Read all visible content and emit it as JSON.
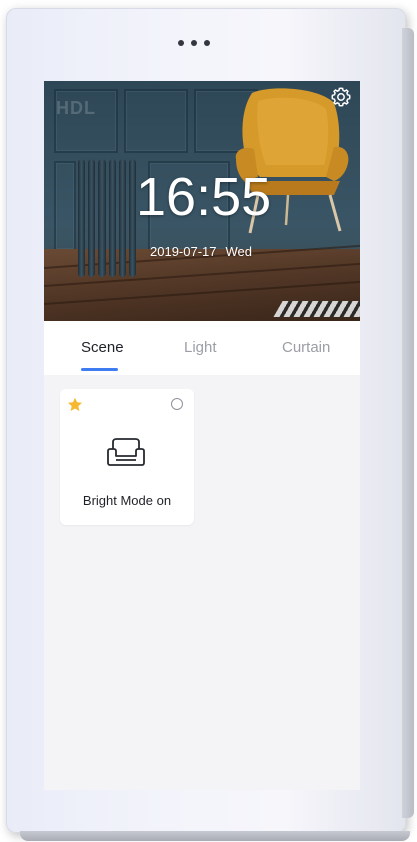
{
  "device": {
    "sensor_dot_count": 3
  },
  "hero": {
    "logo_text": "HDL",
    "time": "16:55",
    "date": "2019-07-17",
    "weekday": "Wed",
    "settings_icon": "gear-icon"
  },
  "tabs": [
    {
      "label": "Scene",
      "active": true
    },
    {
      "label": "Light",
      "active": false
    },
    {
      "label": "Curtain",
      "active": false
    }
  ],
  "scenes": [
    {
      "label": "Bright Mode on",
      "icon": "sofa-icon",
      "favorite": true,
      "selected": false
    }
  ],
  "colors": {
    "accent": "#3f7cf2",
    "star": "#f5b82e",
    "active_tab_text": "#1f2228",
    "inactive_tab_text": "#9b9ea6"
  }
}
